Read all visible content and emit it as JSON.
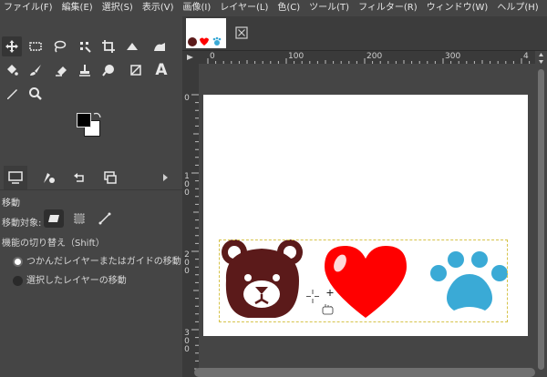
{
  "menubar": {
    "items": [
      "ファイル(F)",
      "編集(E)",
      "選択(S)",
      "表示(V)",
      "画像(I)",
      "レイヤー(L)",
      "色(C)",
      "ツール(T)",
      "フィルター(R)",
      "ウィンドウ(W)",
      "ヘルプ(H)"
    ]
  },
  "tools": [
    "move-tool",
    "rect-select-tool",
    "lasso-tool",
    "fuzzy-select-tool",
    "crop-tool",
    "unified-transform-tool",
    "bucket-fill-tool",
    "paintbrush-tool",
    "eraser-tool",
    "clone-tool",
    "smudge-tool",
    "paths-tool",
    "text-tool",
    "color-picker-tool",
    "zoom-tool"
  ],
  "colors": {
    "foreground": "#000000",
    "background": "#ffffff",
    "bear": "#5b1a1a",
    "heart": "#ff0000",
    "paw": "#3aaad6",
    "selection": "#d6c34a"
  },
  "options": {
    "title": "移動",
    "target_label": "移動対象:",
    "toggle_label": "機能の切り替え（Shift）",
    "radio1": "つかんだレイヤーまたはガイドの移動",
    "radio2": "選択したレイヤーの移動"
  },
  "ruler": {
    "top_labels": [
      "0",
      "100",
      "200",
      "300",
      "4"
    ],
    "left_labels": [
      "0",
      "100",
      "200",
      "300"
    ]
  }
}
